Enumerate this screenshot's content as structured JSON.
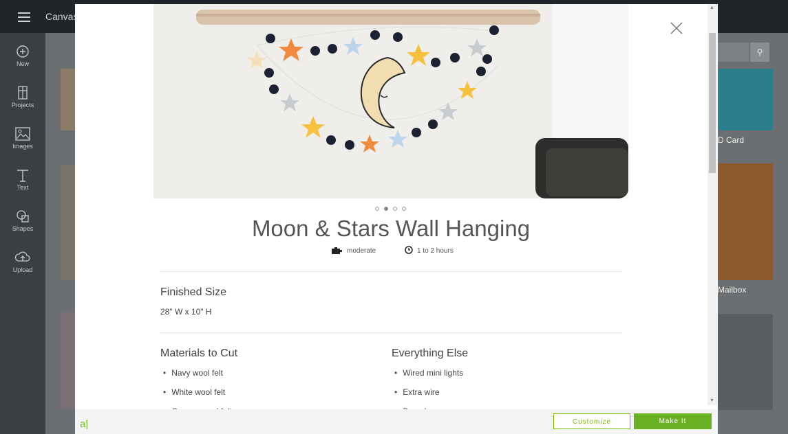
{
  "app": {
    "title": "Canvas"
  },
  "sidebar": {
    "items": [
      {
        "label": "New",
        "icon": "plus-circle-icon"
      },
      {
        "label": "Projects",
        "icon": "projects-icon"
      },
      {
        "label": "Images",
        "icon": "image-icon"
      },
      {
        "label": "Text",
        "icon": "text-icon"
      },
      {
        "label": "Shapes",
        "icon": "shapes-icon"
      },
      {
        "label": "Upload",
        "icon": "upload-icon"
      }
    ]
  },
  "background": {
    "cards": [
      {
        "label": "D Card"
      },
      {
        "label": "Mailbox"
      }
    ]
  },
  "modal": {
    "title": "Moon & Stars Wall Hanging",
    "carousel": {
      "count": 4,
      "active_index": 1
    },
    "difficulty": "moderate",
    "time": "1 to 2 hours",
    "finished_size": {
      "heading": "Finished Size",
      "value": "28\" W x 10\" H"
    },
    "materials": {
      "heading": "Materials to Cut",
      "items": [
        "Navy wool felt",
        "White wool felt",
        "Orange wool felt"
      ]
    },
    "everything_else": {
      "heading": "Everything Else",
      "items": [
        "Wired mini lights",
        "Extra wire",
        "Branch"
      ]
    }
  },
  "footer": {
    "brand": "a|",
    "customize_label": "Customize",
    "make_label": "Make It"
  },
  "colors": {
    "accent": "#6ab023",
    "topbar": "#1f2528",
    "sidebar": "#3b3f41"
  }
}
